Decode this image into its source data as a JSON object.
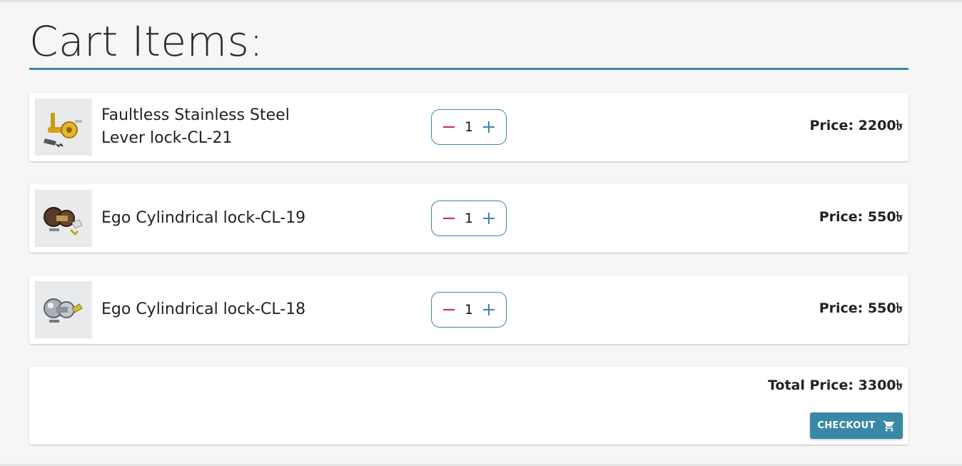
{
  "page": {
    "title": "Cart Items:"
  },
  "colors": {
    "accent": "#3a88a8",
    "minus": "#c8284d"
  },
  "cart": {
    "items": [
      {
        "name": "Faultless Stainless Steel Lever lock-CL-21",
        "quantity": "1",
        "price_label": "Price: 2200৳",
        "image_icon": "gold-lever-lock-image"
      },
      {
        "name": "Ego Cylindrical lock-CL-19",
        "quantity": "1",
        "price_label": "Price: 550৳",
        "image_icon": "cylindrical-lock-image"
      },
      {
        "name": "Ego Cylindrical lock-CL-18",
        "quantity": "1",
        "price_label": "Price: 550৳",
        "image_icon": "cylindrical-lock-image"
      }
    ]
  },
  "summary": {
    "total_label": "Total Price: 3300৳",
    "checkout_label": "CHECKOUT",
    "checkout_icon": "cart-icon"
  }
}
